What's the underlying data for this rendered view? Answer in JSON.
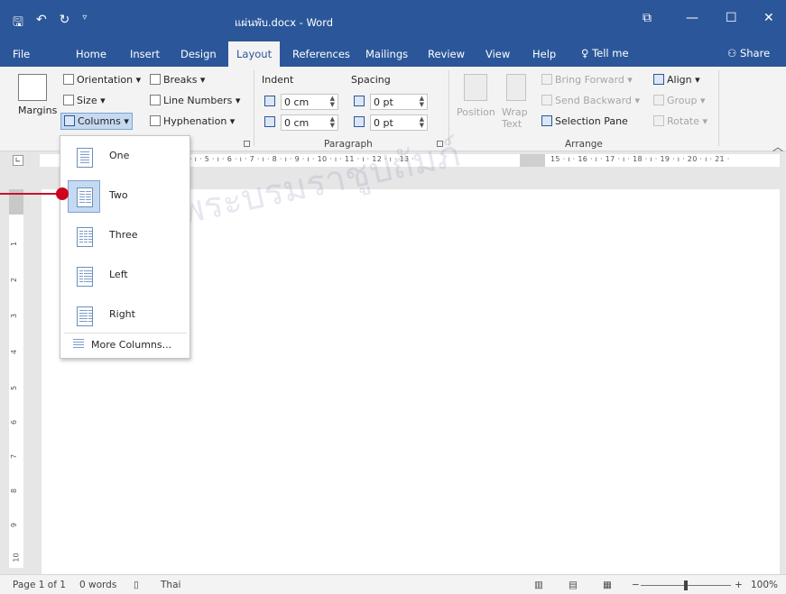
{
  "window": {
    "title": "แผ่นพับ.docx - Word",
    "controls": [
      "⧉",
      "—",
      "☐",
      "✕"
    ]
  },
  "tabs": [
    {
      "label": "File"
    },
    {
      "label": "Home"
    },
    {
      "label": "Insert"
    },
    {
      "label": "Design"
    },
    {
      "label": "Layout",
      "active": true
    },
    {
      "label": "References"
    },
    {
      "label": "Mailings"
    },
    {
      "label": "Review"
    },
    {
      "label": "View"
    },
    {
      "label": "Help"
    }
  ],
  "tellme": "Tell me",
  "share": "Share",
  "ribbon": {
    "page_setup": {
      "margins": "Margins",
      "orientation": "Orientation ▾",
      "size": "Size ▾",
      "columns": "Columns ▾",
      "breaks": "Breaks ▾",
      "line_numbers": "Line Numbers ▾",
      "hyphenation": "Hyphenation ▾"
    },
    "paragraph": {
      "indent_label": "Indent",
      "spacing_label": "Spacing",
      "indent_left": "0 cm",
      "indent_right": "0 cm",
      "spacing_before": "0 pt",
      "spacing_after": "0 pt",
      "group_label": "Paragraph"
    },
    "arrange": {
      "position": "Position",
      "wrap_text": "Wrap Text",
      "bring_forward": "Bring Forward",
      "send_backward": "Send Backward",
      "selection_pane": "Selection Pane",
      "align": "Align ▾",
      "group": "Group ▾",
      "rotate": "Rotate ▾",
      "group_label": "Arrange"
    }
  },
  "ruler_marks": "· ı · 5 · ı · 6 · ı · 7 · ı · 8 · ı · 9 · ı · 10 · ı · 11 · ı · 12 · ı · 13 ·",
  "ruler_marks_right": "15 · ı · 16 · ı · 17 · ı · 18 · ı · 19 · ı · 20 · ı · 21 ·",
  "vruler_numbers": [
    "1",
    "2",
    "3",
    "4",
    "5",
    "6",
    "7",
    "8",
    "9",
    "10"
  ],
  "columns_menu": {
    "options": [
      {
        "label": "One",
        "cols": 1
      },
      {
        "label": "Two",
        "cols": 2,
        "hover": true
      },
      {
        "label": "Three",
        "cols": 3
      },
      {
        "label": "Left",
        "cols": "left"
      },
      {
        "label": "Right",
        "cols": "right"
      }
    ],
    "more": "More Columns..."
  },
  "status": {
    "page": "Page 1 of 1",
    "words": "0 words",
    "language": "Thai",
    "zoom": "100%"
  },
  "watermark": "ในพระบรมราชูปถัมภ์"
}
